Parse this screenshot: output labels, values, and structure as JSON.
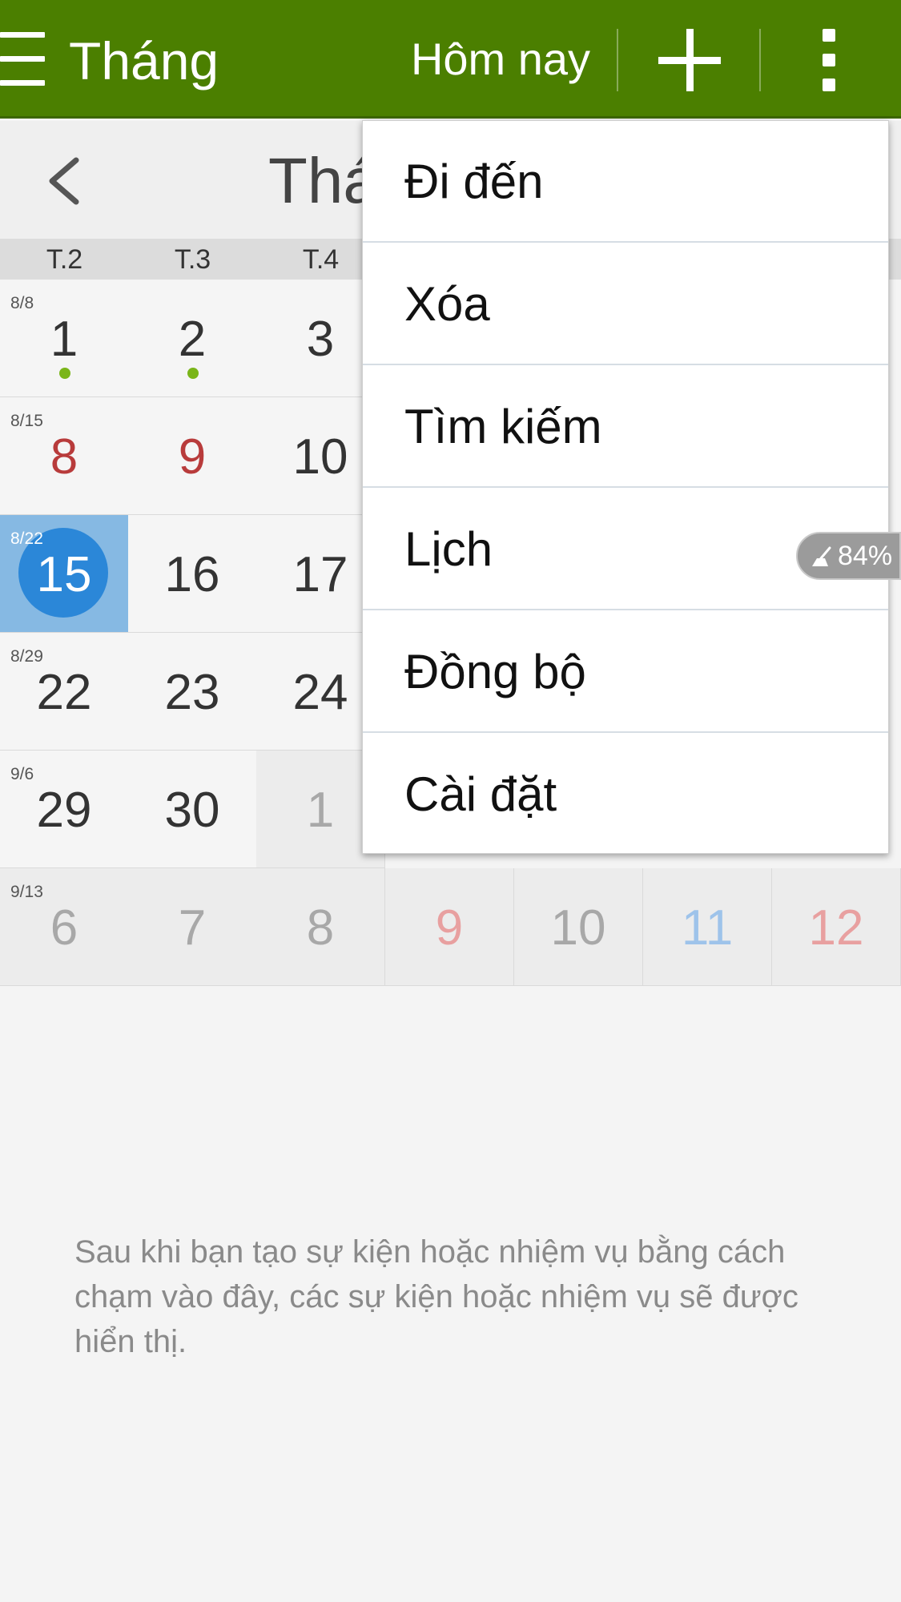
{
  "actionbar": {
    "title": "Tháng",
    "today_label": "Hôm nay",
    "add_icon": "plus-icon",
    "more_icon": "more-vertical-icon",
    "menu_icon": "hamburger-icon",
    "color": "#4b7f00"
  },
  "month_header": {
    "title_partial": "Thá",
    "back_icon": "chevron-left-icon"
  },
  "weekdays": [
    "T.2",
    "T.3",
    "T.4"
  ],
  "calendar": {
    "weeks": [
      {
        "label": "8/8",
        "days": [
          "1",
          "2",
          "3"
        ]
      },
      {
        "label": "8/15",
        "days": [
          "8",
          "9",
          "10"
        ]
      },
      {
        "label": "8/22",
        "days": [
          "15",
          "16",
          "17"
        ]
      },
      {
        "label": "8/29",
        "days": [
          "22",
          "23",
          "24"
        ]
      },
      {
        "label": "9/6",
        "days": [
          "29",
          "30",
          "1"
        ]
      },
      {
        "label": "9/13",
        "days": [
          "6",
          "7",
          "8",
          "9",
          "10",
          "11",
          "12"
        ]
      }
    ],
    "today_color": "#2b87d8",
    "event_dot_color": "#7ab519"
  },
  "menu": {
    "items": [
      "Đi đến",
      "Xóa",
      "Tìm kiếm",
      "Lịch",
      "Đồng bộ",
      "Cài đặt"
    ]
  },
  "battery": {
    "text": "84%",
    "icon": "broom-icon"
  },
  "hint": "Sau khi bạn tạo sự kiện hoặc nhiệm vụ bằng cách chạm vào đây, các sự kiện hoặc nhiệm vụ sẽ được hiển thị."
}
